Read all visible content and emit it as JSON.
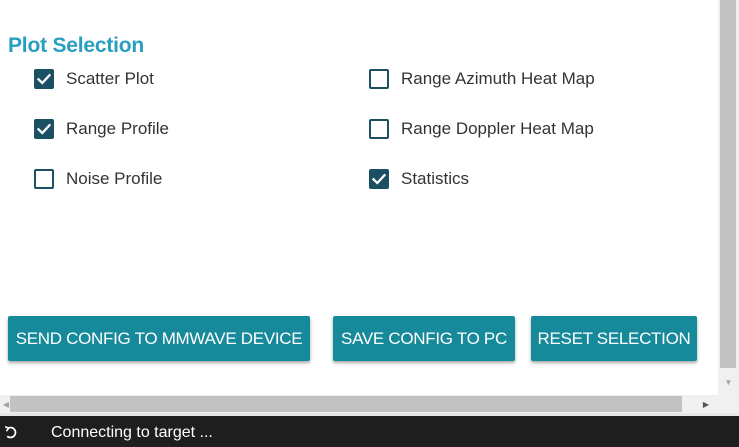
{
  "plot_selection": {
    "title": "Plot Selection",
    "options": [
      {
        "label": "Scatter Plot",
        "checked": true
      },
      {
        "label": "Range Profile",
        "checked": true
      },
      {
        "label": "Noise Profile",
        "checked": false
      },
      {
        "label": "Range Azimuth Heat Map",
        "checked": false
      },
      {
        "label": "Range Doppler Heat Map",
        "checked": false
      },
      {
        "label": "Statistics",
        "checked": true
      }
    ]
  },
  "actions": {
    "send_config": "SEND CONFIG TO MMWAVE DEVICE",
    "save_config": "SAVE CONFIG TO PC",
    "reset_selection": "RESET SELECTION"
  },
  "status": {
    "text": "Connecting to target ...",
    "icon": "spinner-icon"
  },
  "colors": {
    "title": "#2a9ec1",
    "checkbox": "#1b4f63",
    "button": "#16899a",
    "statusbar": "#1e1e1e"
  }
}
